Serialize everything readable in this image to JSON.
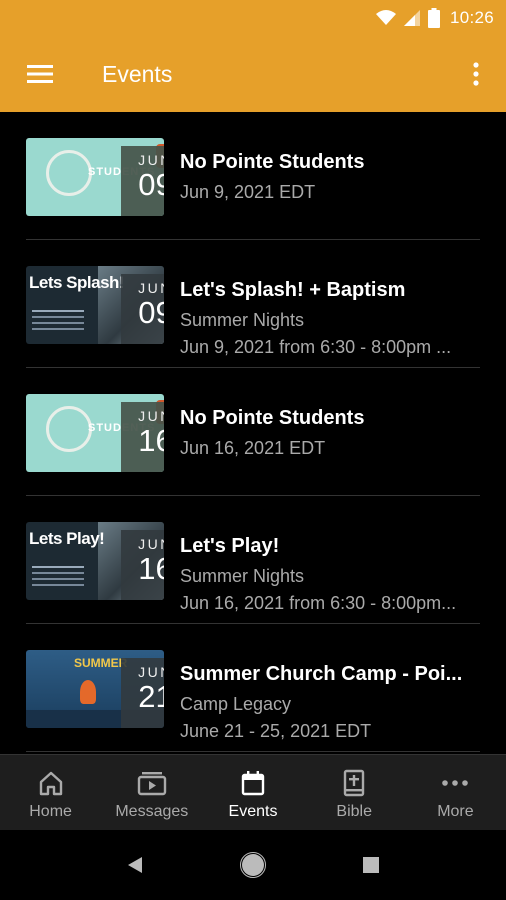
{
  "status": {
    "time": "10:26"
  },
  "header": {
    "title": "Events"
  },
  "events": [
    {
      "thumb_text": "STUDENTS",
      "month": "JUN",
      "day": "09",
      "title": "No Pointe Students",
      "line1": "Jun 9, 2021 EDT",
      "line2": ""
    },
    {
      "thumb_text": "Lets Splash!",
      "month": "JUN",
      "day": "09",
      "title": "Let's Splash! + Baptism",
      "line1": "Summer Nights",
      "line2": "Jun 9, 2021 from 6:30 - 8:00pm ..."
    },
    {
      "thumb_text": "STUDENTS",
      "month": "JUN",
      "day": "16",
      "title": "No Pointe Students",
      "line1": "Jun 16, 2021 EDT",
      "line2": ""
    },
    {
      "thumb_text": "Lets Play!",
      "month": "JUN",
      "day": "16",
      "title": "Let's Play!",
      "line1": "Summer Nights",
      "line2": "Jun 16, 2021 from 6:30 - 8:00pm..."
    },
    {
      "thumb_text": "SUMMER",
      "month": "JUN",
      "day": "21",
      "title": "Summer Church Camp - Poi...",
      "line1": "Camp Legacy",
      "line2": "June 21 - 25, 2021 EDT"
    }
  ],
  "bottom_nav": [
    {
      "label": "Home",
      "icon": "home-icon"
    },
    {
      "label": "Messages",
      "icon": "play-icon"
    },
    {
      "label": "Events",
      "icon": "calendar-icon",
      "active": true
    },
    {
      "label": "Bible",
      "icon": "bible-icon"
    },
    {
      "label": "More",
      "icon": "more-icon"
    }
  ],
  "colors": {
    "accent": "#e6a02a",
    "background": "#000000",
    "nav_background": "#1e1e1e"
  }
}
